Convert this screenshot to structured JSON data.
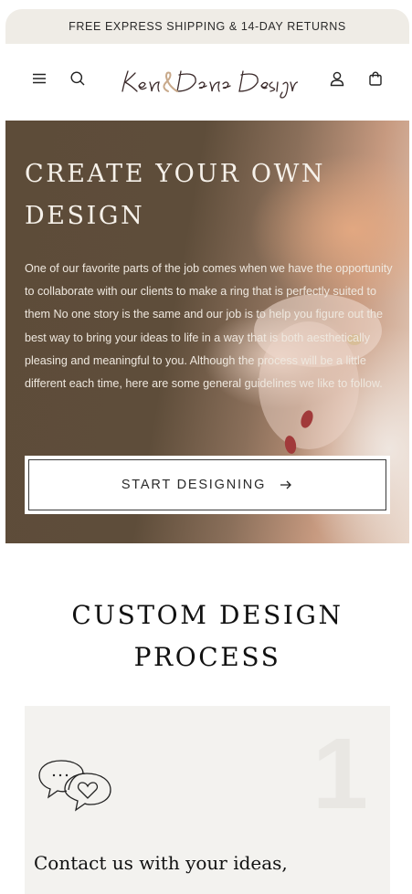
{
  "announcement": {
    "text": "FREE EXPRESS SHIPPING & 14-DAY RETURNS"
  },
  "header": {
    "logo_alt": "Ken & Dana Design",
    "icons": [
      "menu-icon",
      "search-icon",
      "account-icon",
      "bag-icon"
    ]
  },
  "hero": {
    "title": "CREATE YOUR OWN DESIGN",
    "body": "One of our favorite parts of the job comes when we have the opportunity to collaborate with our clients to make a ring that is perfectly suited to them No one story is the same and our job is to help you figure out the best way to bring your ideas to life in a way that is both aesthetically pleasing and meaningful to you. Although the process will be a little different each time, here are some general guidelines we like to follow.",
    "cta_label": "START DESIGNING"
  },
  "process": {
    "title": "CUSTOM DESIGN PROCESS",
    "steps": [
      {
        "number": "1",
        "icon": "chat-heart-icon",
        "heading": "Contact us with your ideas,"
      }
    ]
  },
  "colors": {
    "announcement_bg": "#efece6",
    "hero_dark": "#5d4c39",
    "card_bg": "#f3f2ef",
    "logo_accent": "#c8a98a"
  }
}
